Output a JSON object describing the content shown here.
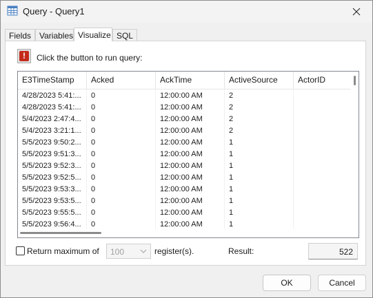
{
  "window": {
    "title": "Query - Query1"
  },
  "tabs": [
    {
      "label": "Fields",
      "active": false
    },
    {
      "label": "Variables",
      "active": false
    },
    {
      "label": "Visualize",
      "active": true
    },
    {
      "label": "SQL",
      "active": false
    }
  ],
  "run": {
    "label": "Click the button to run query:",
    "icon": "exclamation-icon"
  },
  "table": {
    "columns": [
      "E3TimeStamp",
      "Acked",
      "AckTime",
      "ActiveSource",
      "ActorID"
    ],
    "rows": [
      [
        "4/28/2023 5:41:...",
        "0",
        "12:00:00 AM",
        "2",
        ""
      ],
      [
        "4/28/2023 5:41:...",
        "0",
        "12:00:00 AM",
        "2",
        ""
      ],
      [
        "5/4/2023 2:47:4...",
        "0",
        "12:00:00 AM",
        "2",
        ""
      ],
      [
        "5/4/2023 3:21:1...",
        "0",
        "12:00:00 AM",
        "2",
        ""
      ],
      [
        "5/5/2023 9:50:2...",
        "0",
        "12:00:00 AM",
        "1",
        ""
      ],
      [
        "5/5/2023 9:51:3...",
        "0",
        "12:00:00 AM",
        "1",
        ""
      ],
      [
        "5/5/2023 9:52:3...",
        "0",
        "12:00:00 AM",
        "1",
        ""
      ],
      [
        "5/5/2023 9:52:5...",
        "0",
        "12:00:00 AM",
        "1",
        ""
      ],
      [
        "5/5/2023 9:53:3...",
        "0",
        "12:00:00 AM",
        "1",
        ""
      ],
      [
        "5/5/2023 9:53:5...",
        "0",
        "12:00:00 AM",
        "1",
        ""
      ],
      [
        "5/5/2023 9:55:5...",
        "0",
        "12:00:00 AM",
        "1",
        ""
      ],
      [
        "5/5/2023 9:56:4...",
        "0",
        "12:00:00 AM",
        "1",
        ""
      ]
    ]
  },
  "options": {
    "return_max_label": "Return maximum of",
    "max_value": "100",
    "register_label": "register(s).",
    "result_label": "Result:",
    "result_value": "522"
  },
  "buttons": {
    "ok": "OK",
    "cancel": "Cancel"
  },
  "colors": {
    "accent": "#c42b1c"
  }
}
